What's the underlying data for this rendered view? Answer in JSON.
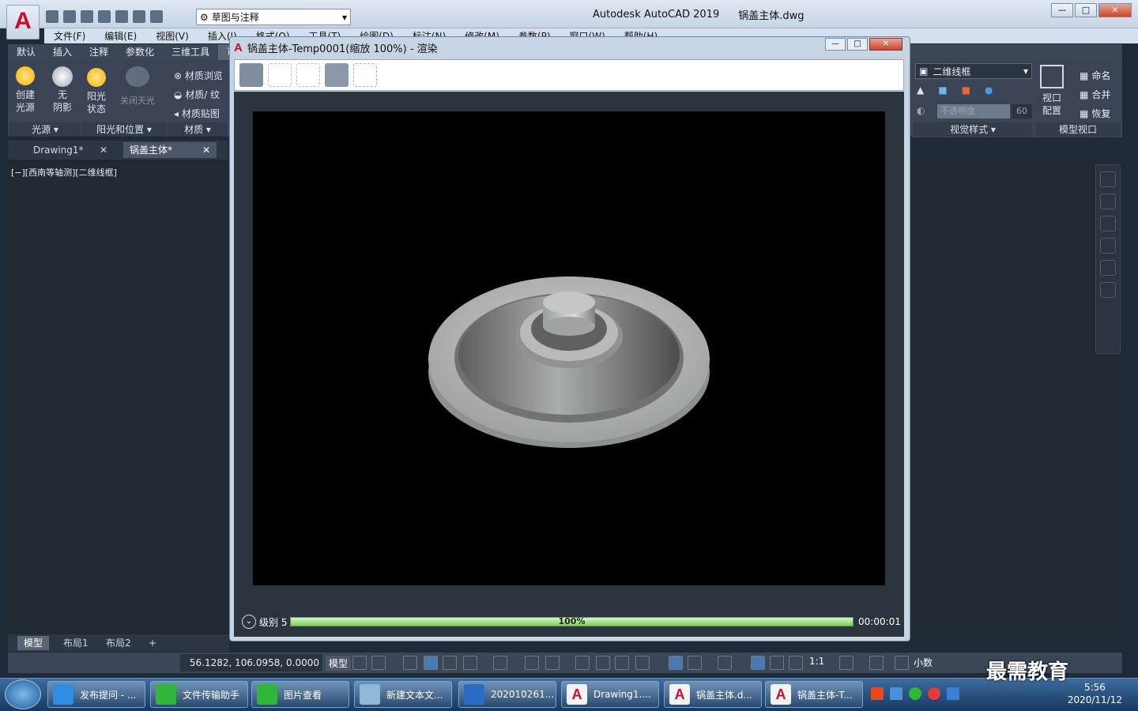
{
  "app": {
    "logo": "A",
    "title": "Autodesk AutoCAD 2019",
    "file": "锅盖主体.dwg",
    "workspace": "草图与注释",
    "search_hint": ""
  },
  "menu": [
    "文件(F)",
    "编辑(E)",
    "视图(V)",
    "插入(I)",
    "格式(O)",
    "工具(T)",
    "绘图(D)",
    "标注(N)",
    "修改(M)",
    "参数(P)",
    "窗口(W)",
    "帮助(H)"
  ],
  "ribbon_tabs": [
    "默认",
    "插入",
    "注释",
    "参数化",
    "三维工具",
    "可"
  ],
  "ribbon": {
    "create_light": "创建\n光源",
    "no_shadow": "无\n阴影",
    "sun_state": "阳光\n状态",
    "turn_off_sun": "关闭天光",
    "mat_browser": "材质浏览",
    "mat_tex": "材质/ 纹",
    "mat_map": "材质贴图",
    "group_light": "光源",
    "group_sun": "阳光和位置",
    "group_mat": "材质",
    "visual_style": "二维线框",
    "opacity": "不透明度",
    "opacity_value": "60",
    "group_visual": "视觉样式",
    "viewport_config": "视口\n配置",
    "name": "命名",
    "merge": "合并",
    "restore": "恢复",
    "group_model_vp": "模型视口"
  },
  "doc_tabs": [
    "Drawing1*",
    "锅盖主体*"
  ],
  "viewport_label": "[−][西南等轴测][二维线框]",
  "layout_tabs": [
    "模型",
    "布局1",
    "布局2",
    "+"
  ],
  "status": {
    "coords": "56.1282, 106.0958, 0.0000",
    "model": "模型",
    "scale": "1:1",
    "units": "小数"
  },
  "render_window": {
    "title": "锅盖主体-Temp0001(缩放 100%) - 渲染",
    "level": "级别 5",
    "progress_percent": 100,
    "progress_label": "100%",
    "elapsed": "00:00:01"
  },
  "taskbar": [
    {
      "label": "发布提问 - ...",
      "icon": "ie-icon",
      "color": "#2f8de4"
    },
    {
      "label": "文件传输助手",
      "icon": "wechat-icon",
      "color": "#2fb838"
    },
    {
      "label": "图片查看",
      "icon": "wechat-icon",
      "color": "#2fb838"
    },
    {
      "label": "新建文本文...",
      "icon": "notepad-icon",
      "color": "#8fb7d8"
    },
    {
      "label": "202010261...",
      "icon": "word-icon",
      "color": "#2b6cc4"
    },
    {
      "label": "Drawing1....",
      "icon": "autocad-icon",
      "color": "#c8102e"
    },
    {
      "label": "锅盖主体.d...",
      "icon": "autocad-icon",
      "color": "#c8102e"
    },
    {
      "label": "锅盖主体-T...",
      "icon": "autocad-icon",
      "color": "#c8102e"
    }
  ],
  "clock": {
    "time": "5:56",
    "date": "2020/11/12"
  },
  "watermark": "最需教育"
}
